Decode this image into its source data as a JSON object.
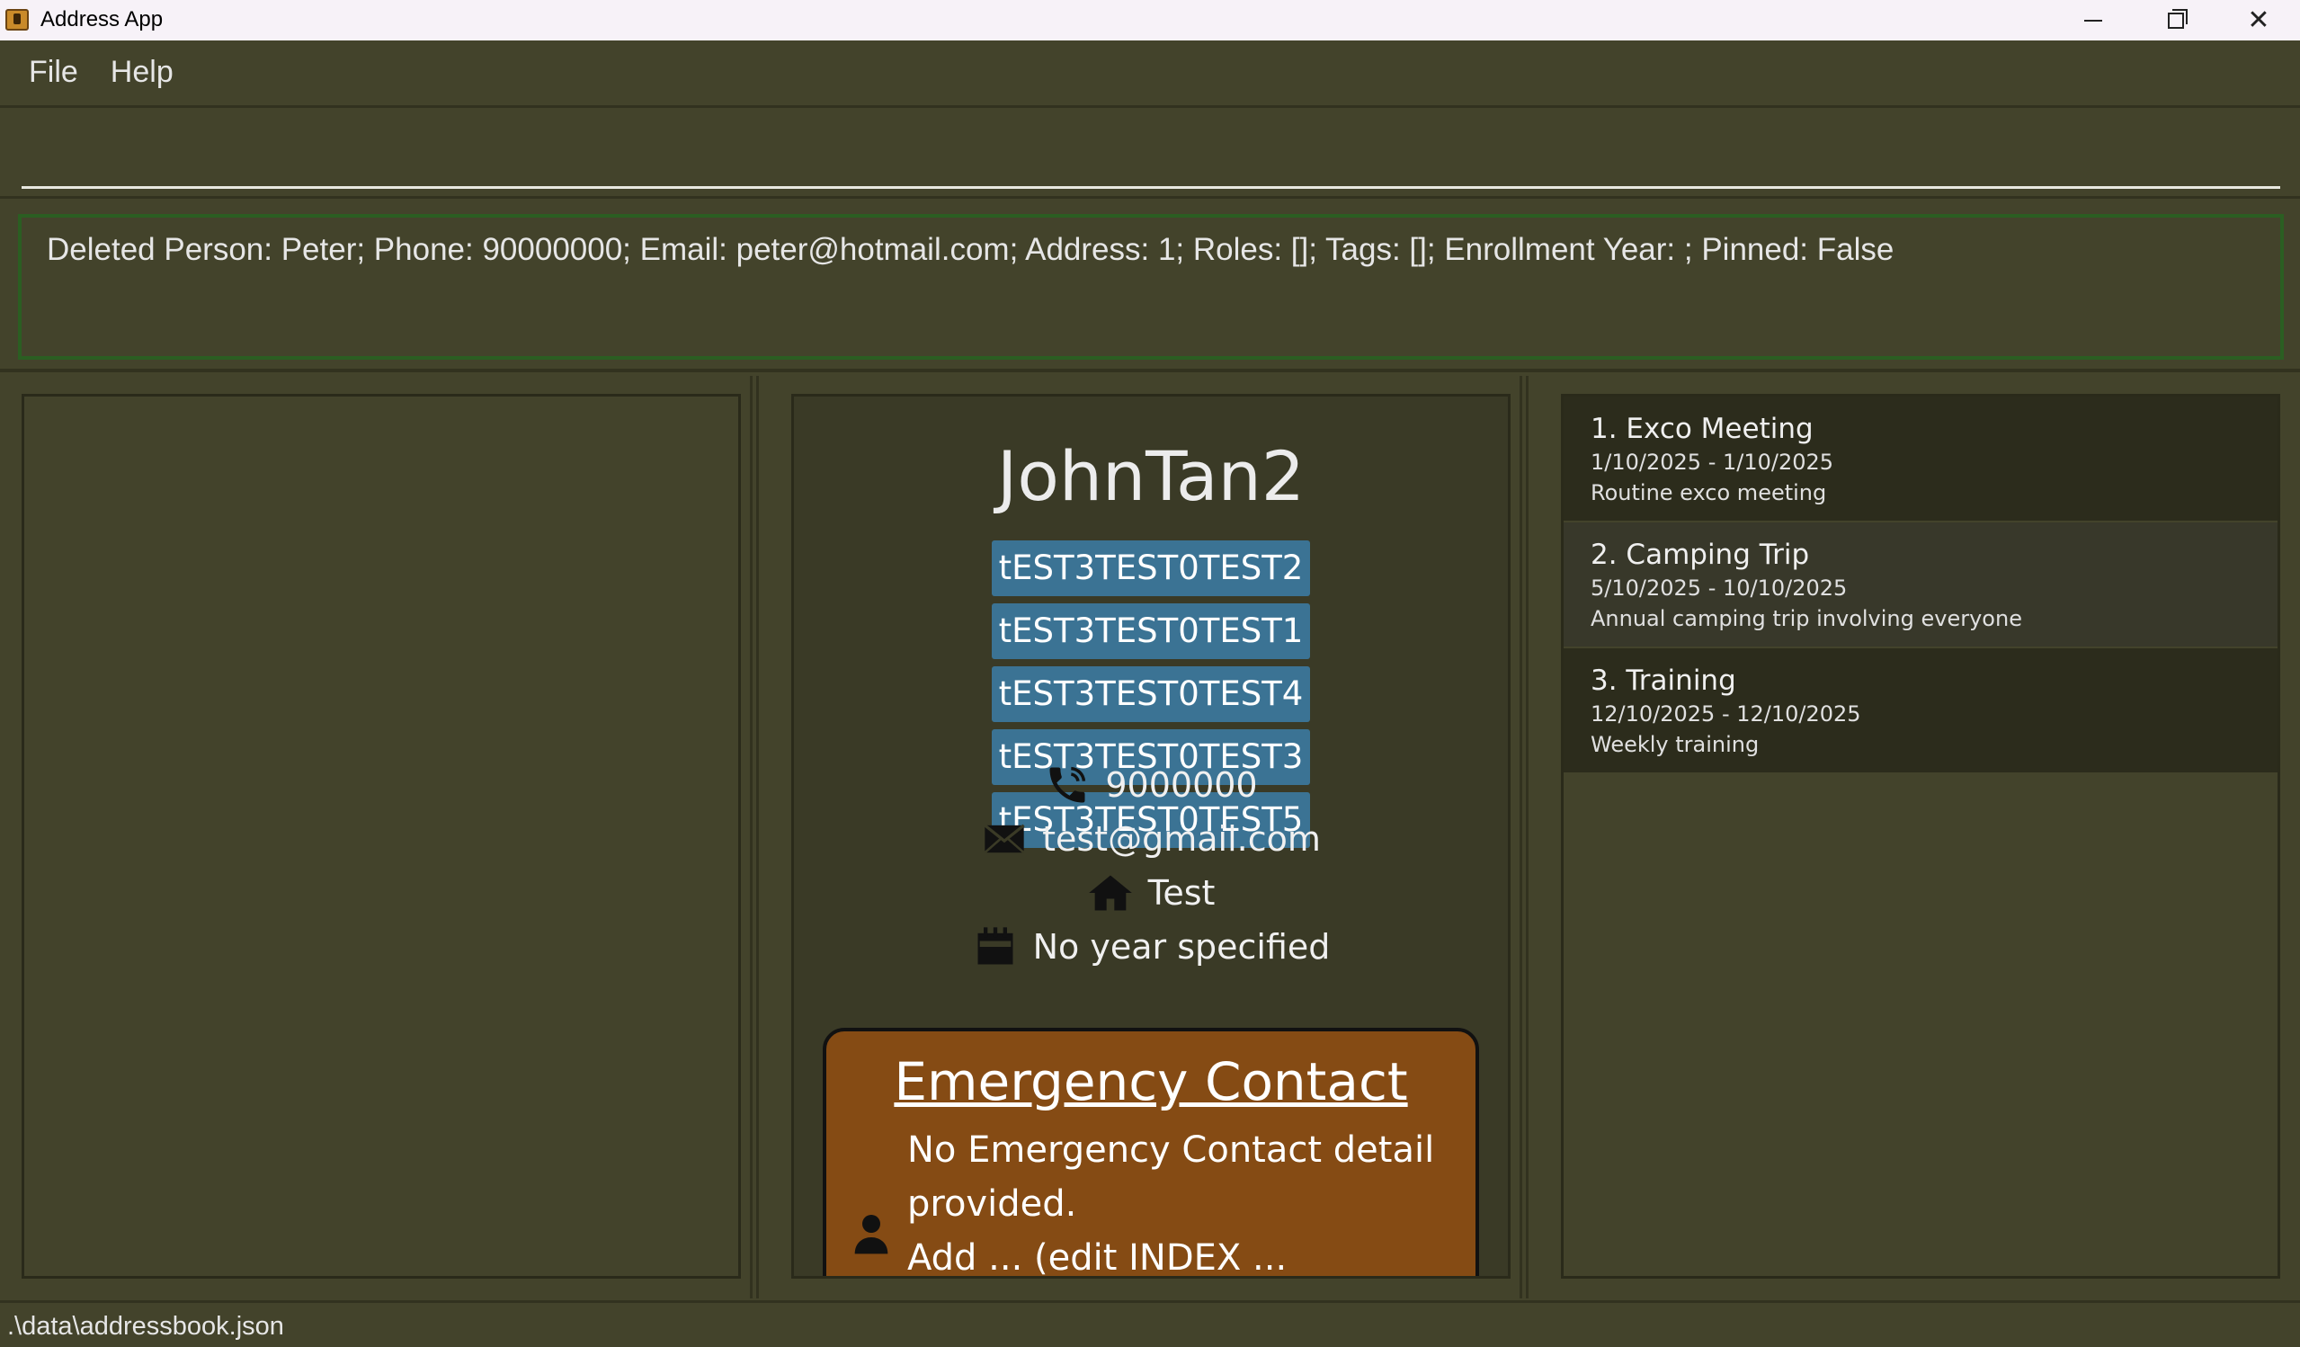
{
  "window": {
    "title": "Address App",
    "close_glyph": "✕"
  },
  "menu": {
    "items": [
      {
        "label": "File"
      },
      {
        "label": "Help"
      }
    ]
  },
  "command": {
    "value": "",
    "placeholder": ""
  },
  "result": {
    "text": "Deleted Person: Peter; Phone: 90000000; Email: peter@hotmail.com; Address: 1; Roles: []; Tags: []; Enrollment Year: ; Pinned: False"
  },
  "person": {
    "name": "JohnTan2",
    "tags": [
      "tEST3TEST0TEST2",
      "tEST3TEST0TEST1",
      "tEST3TEST0TEST4",
      "tEST3TEST0TEST3",
      "tEST3TEST0TEST5"
    ],
    "phone": "9000000",
    "email": "test@gmail.com",
    "address": "Test",
    "year": "No year specified",
    "icons": {
      "phone": "phone-icon",
      "email": "email-icon",
      "address": "home-icon",
      "year": "calendar-icon"
    },
    "emergency": {
      "title": "Emergency Contact",
      "text": "No Emergency Contact detail provided.",
      "extra": "Add ...   (edit INDEX ..."
    }
  },
  "events": [
    {
      "title": "1. Exco Meeting",
      "date": "1/10/2025 - 1/10/2025",
      "desc": "Routine exco meeting"
    },
    {
      "title": "2. Camping Trip",
      "date": "5/10/2025 - 10/10/2025",
      "desc": "Annual camping trip involving everyone"
    },
    {
      "title": "3. Training",
      "date": "12/10/2025 - 12/10/2025",
      "desc": "Weekly training"
    }
  ],
  "status": {
    "path": ".\\data\\addressbook.json"
  },
  "colors": {
    "background": "#43432b",
    "tag": "#3b7394",
    "emergency": "#854b14",
    "result_border": "#2b5e22"
  }
}
